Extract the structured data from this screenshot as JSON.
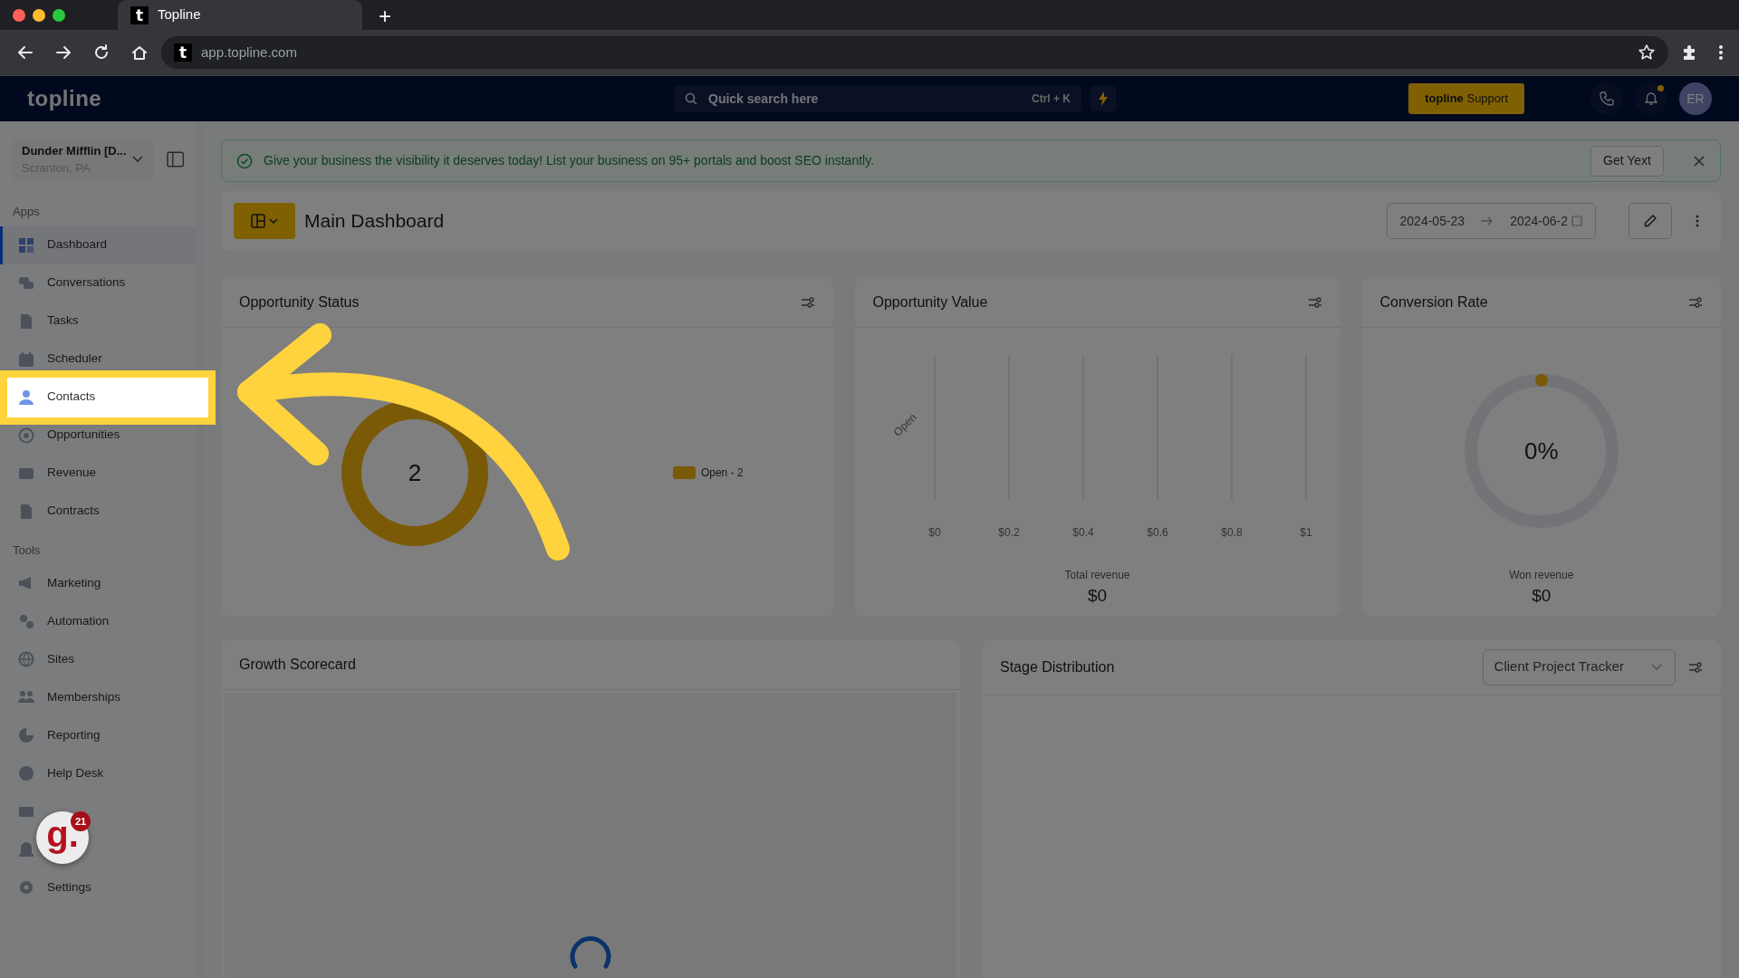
{
  "browser": {
    "tab": {
      "favicon": "t",
      "title": "Topline",
      "selected": true
    },
    "new_tab": "+",
    "address": {
      "favicon": "t",
      "url": "app.topline.com"
    }
  },
  "header": {
    "logo": "topline",
    "search": {
      "placeholder": "Quick search here",
      "shortcut": "Ctrl + K"
    },
    "support_button": "**topline** Support",
    "notifications": {
      "unread": true
    },
    "avatar": "ER"
  },
  "sidebar": {
    "account": {
      "name": "Dunder Mifflin [D...",
      "location": "Scranton, PA"
    },
    "sections": [
      {
        "title": "Apps",
        "items": [
          {
            "label": "Dashboard",
            "selected": true,
            "highlighted": false
          },
          {
            "label": "Conversations",
            "selected": false,
            "highlighted": false
          },
          {
            "label": "Tasks",
            "selected": false,
            "highlighted": false
          },
          {
            "label": "Scheduler",
            "selected": false,
            "highlighted": false
          },
          {
            "label": "Contacts",
            "selected": false,
            "highlighted": true
          },
          {
            "label": "Opportunities",
            "selected": false,
            "highlighted": false
          },
          {
            "label": "Revenue",
            "selected": false,
            "highlighted": false
          },
          {
            "label": "Contracts",
            "selected": false,
            "highlighted": false
          }
        ]
      },
      {
        "title": "Tools",
        "items": [
          {
            "label": "Marketing",
            "selected": false,
            "highlighted": false
          },
          {
            "label": "Automation",
            "selected": false,
            "highlighted": false
          },
          {
            "label": "Sites",
            "selected": false,
            "highlighted": false
          },
          {
            "label": "Memberships",
            "selected": false,
            "highlighted": false
          },
          {
            "label": "Reporting",
            "selected": false,
            "highlighted": false
          },
          {
            "label": "Help Desk",
            "selected": false,
            "highlighted": false
          },
          {
            "selected": false,
            "highlighted": false
          },
          {
            "selected": false,
            "highlighted": false
          },
          {
            "label": "Settings",
            "selected": false,
            "highlighted": false
          }
        ]
      }
    ]
  },
  "banner": {
    "message": "Give your business the visibility it deserves today! List your business on 95+ portals and boost SEO instantly.",
    "button": "Get Yext"
  },
  "dashboard": {
    "title": "Main Dashboard",
    "date_start": "2024-05-23",
    "date_end": "2024-06-2"
  },
  "opportunity_status": {
    "title": "Opportunity Status",
    "center_value": "2",
    "legend": "Open - 2"
  },
  "opportunity_value": {
    "title": "Opportunity Value",
    "chart_data": {
      "type": "bar",
      "orientation": "horizontal",
      "grid": true,
      "categories": [
        "Open"
      ],
      "values": [
        0
      ],
      "xlim": [
        0,
        1
      ],
      "xticks": [
        {
          "value": 0,
          "label": "$0"
        },
        {
          "value": 0.2,
          "label": "$0.2"
        },
        {
          "value": 0.4,
          "label": "$0.4"
        },
        {
          "value": 0.6,
          "label": "$0.6"
        },
        {
          "value": 0.8,
          "label": "$0.8"
        },
        {
          "value": 1,
          "label": "$1"
        }
      ]
    },
    "total_label": "Total revenue",
    "total": "$0"
  },
  "conversion_rate": {
    "title": "Conversion Rate",
    "rate": "0%",
    "won_label": "Won revenue",
    "won": "$0"
  },
  "growth_scorecard": {
    "title": "Growth Scorecard",
    "loading": true
  },
  "stage_distribution": {
    "title": "Stage Distribution",
    "pipeline_select": "Client Project Tracker"
  },
  "helper_widget": {
    "logo": "g.",
    "badge": "21"
  }
}
